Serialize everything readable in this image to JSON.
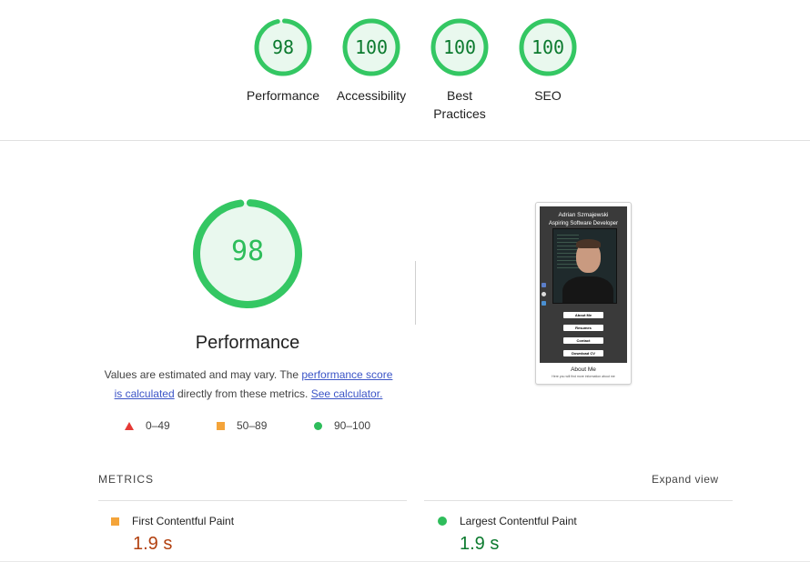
{
  "categories": [
    {
      "score": "98",
      "label": "Performance",
      "fraction": 0.98
    },
    {
      "score": "100",
      "label": "Accessibility",
      "fraction": 1.0
    },
    {
      "score": "100",
      "label": "Best Practices",
      "fraction": 1.0
    },
    {
      "score": "100",
      "label": "SEO",
      "fraction": 1.0
    }
  ],
  "performance": {
    "score": "98",
    "fraction": 0.98,
    "title": "Performance",
    "desc_prefix": "Values are estimated and may vary. The ",
    "desc_link1": "performance score is calculated",
    "desc_mid": " directly from these metrics. ",
    "desc_link2": "See calculator."
  },
  "legend": {
    "fail": "0–49",
    "average": "50–89",
    "pass": "90–100"
  },
  "thumbnail": {
    "name": "Adrian Szmajewski",
    "role": "Aspiring Software Developer",
    "buttons": [
      "About Me",
      "Resumes",
      "Contact",
      "Download CV"
    ],
    "about_title": "About Me",
    "about_text": "Here you will find more information about me"
  },
  "metrics": {
    "title": "METRICS",
    "expand_label": "Expand view",
    "items": [
      {
        "name": "First Contentful Paint",
        "value": "1.9 s",
        "status": "average"
      },
      {
        "name": "Largest Contentful Paint",
        "value": "1.9 s",
        "status": "pass"
      }
    ]
  },
  "colors": {
    "pass": "#0cce6b",
    "pass_text": "#0b7a2e",
    "average": "#ffa400",
    "average_text": "#b2400f",
    "fail": "#ff4e42",
    "gauge_fill": "#e5f9ec"
  }
}
